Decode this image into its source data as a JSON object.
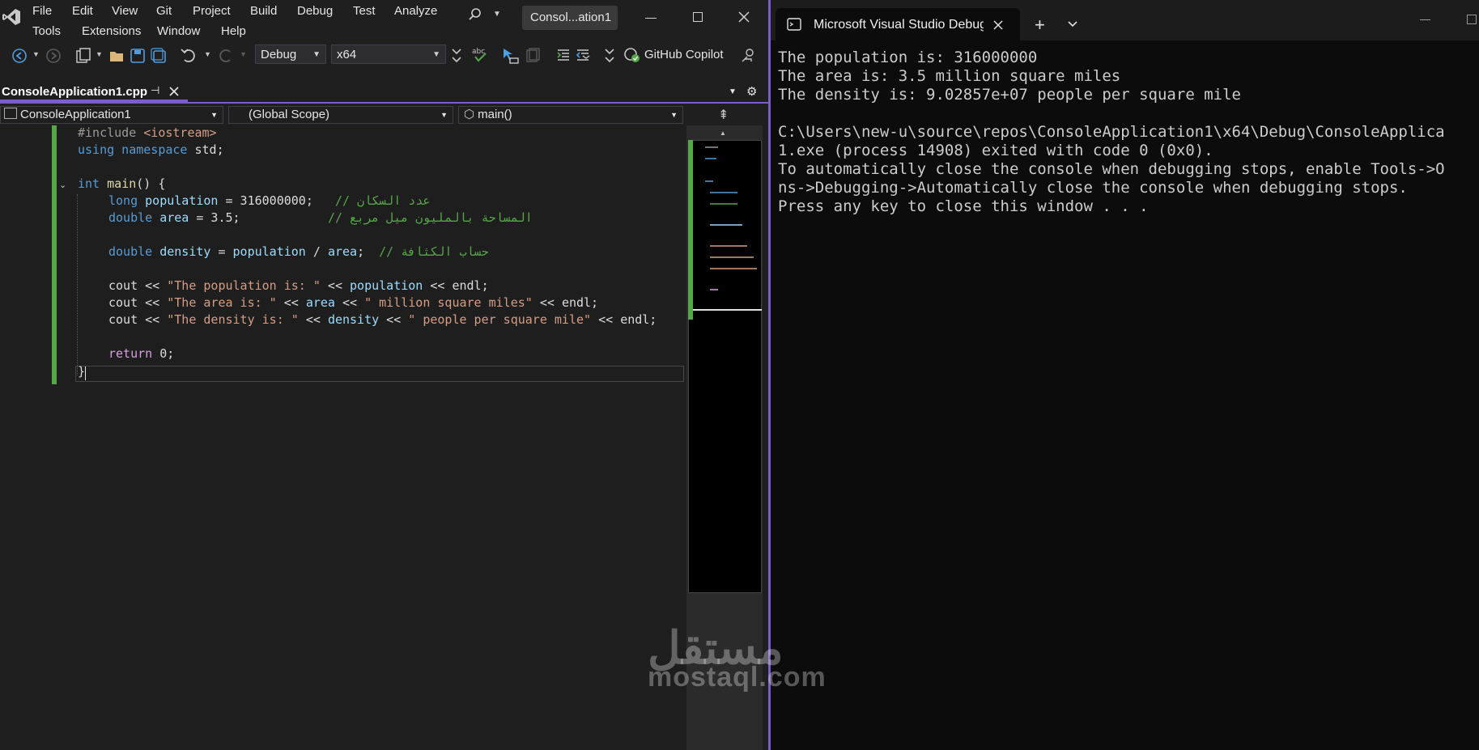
{
  "menu": {
    "row1": [
      "File",
      "Edit",
      "View",
      "Git",
      "Project",
      "Build",
      "Debug",
      "Test",
      "Analyze"
    ],
    "row2": [
      "Tools",
      "Extensions",
      "Window",
      "Help"
    ]
  },
  "title_chip": "Consol...ation1",
  "toolbar": {
    "config": "Debug",
    "platform": "x64",
    "copilot": "GitHub Copilot"
  },
  "tab": {
    "filename": "ConsoleApplication1.cpp"
  },
  "nav": {
    "project": "ConsoleApplication1",
    "scope": "(Global Scope)",
    "member": "main()"
  },
  "code": {
    "l1a": "#include ",
    "l1b": "<iostream>",
    "l2a": "using",
    "l2b": " namespace ",
    "l2c": "std;",
    "l4a": "int",
    "l4b": " main",
    "l4c": "() {",
    "l5a": "long",
    "l5b": " population",
    "l5c": " = 316000000;   ",
    "l5d": "// عدد السكان",
    "l6a": "double",
    "l6b": " area",
    "l6c": " = 3.5;            ",
    "l6d": "// المساحة بالمليون ميل مربع",
    "l8a": "double",
    "l8b": " density",
    "l8c": " = ",
    "l8d": "population",
    "l8e": " / ",
    "l8f": "area",
    "l8g": ";  ",
    "l8h": "// حساب الكثافة",
    "cout": "cout << ",
    "ltlt": " << ",
    "endl": "endl;",
    "s1": "\"The population is: \"",
    "v1": "population",
    "s2": "\"The area is: \"",
    "v2": "area",
    "s2b": "\" million square miles\"",
    "s3": "\"The density is: \"",
    "v3": "density",
    "s3b": "\" people per square mile\"",
    "ret": "return",
    "ret0": " 0;",
    "close": "}"
  },
  "terminal": {
    "tab_title": "Microsoft Visual Studio Debug",
    "lines": [
      "The population is: 316000000",
      "The area is: 3.5 million square miles",
      "The density is: 9.02857e+07 people per square mile",
      "",
      "C:\\Users\\new-u\\source\\repos\\ConsoleApplication1\\x64\\Debug\\ConsoleApplica",
      "1.exe (process 14908) exited with code 0 (0x0).",
      "To automatically close the console when debugging stops, enable Tools->O",
      "ns->Debugging->Automatically close the console when debugging stops.",
      "Press any key to close this window . . ."
    ]
  },
  "watermark": {
    "arabic": "مستقل",
    "latin": "mostaql.com"
  },
  "colors": {
    "accent": "#7a5fc6",
    "change_bar": "#57a64a",
    "terminal_bg": "#0c0c0c"
  }
}
